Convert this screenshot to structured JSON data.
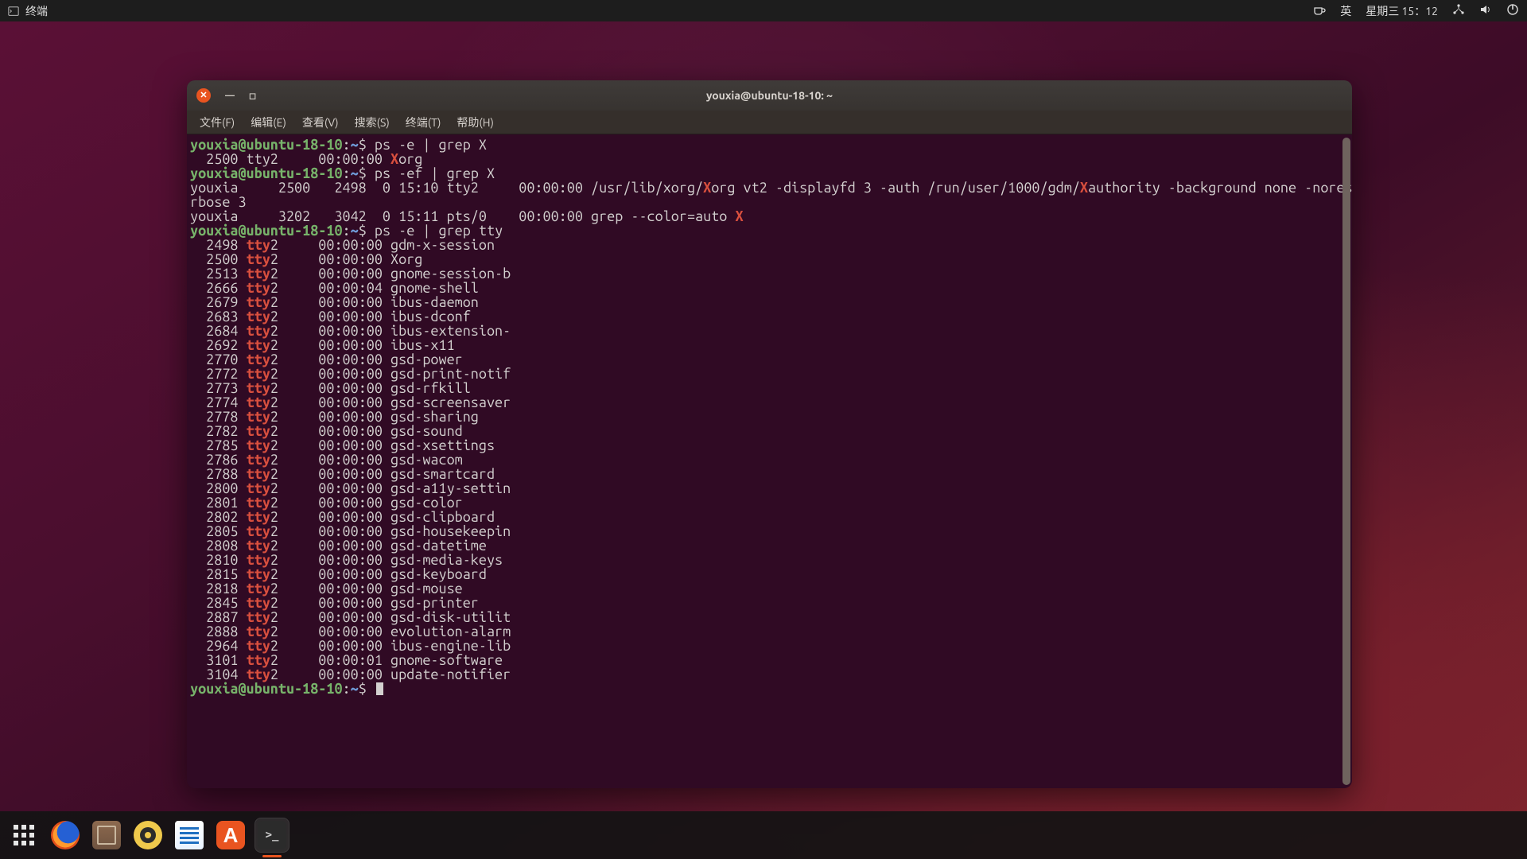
{
  "top_panel": {
    "app_label": "终端",
    "ime": "英",
    "clock": "星期三 15：12"
  },
  "window": {
    "title": "youxia@ubuntu-18-10: ~",
    "menu": [
      "文件(F)",
      "编辑(E)",
      "查看(V)",
      "搜索(S)",
      "终端(T)",
      "帮助(H)"
    ]
  },
  "terminal": {
    "prompt_user_host": "youxia@ubuntu-18-10",
    "prompt_path": "~",
    "prompt_symbol": "$",
    "commands": {
      "c1": "ps -e | grep X",
      "c2": "ps -ef | grep X",
      "c3": "ps -e | grep tty"
    },
    "line_grepX": {
      "pid": "  2500",
      "tty": "tty2",
      "time": "00:00:00",
      "pre": "",
      "hl": "X",
      "post": "org"
    },
    "ef_lines": [
      {
        "pre": "youxia     2500   2498  0 15:10 tty2     00:00:00 /usr/lib/xorg/",
        "hl1": "X",
        "mid": "org vt2 -displayfd 3 -auth /run/user/1000/gdm/",
        "hl2": "X",
        "post": "authority -background none -noreset -keeptty -ve"
      },
      {
        "pre": "rbose 3"
      },
      {
        "pre": "youxia     3202   3042  0 15:11 pts/0    00:00:00 grep --color=auto ",
        "hl1": "X"
      }
    ],
    "tty_rows": [
      {
        "pid": "  2498",
        "tty": "tty",
        "n": "2",
        "time": "00:00:00",
        "cmd": "gdm-x-session"
      },
      {
        "pid": "  2500",
        "tty": "tty",
        "n": "2",
        "time": "00:00:00",
        "cmd": "Xorg"
      },
      {
        "pid": "  2513",
        "tty": "tty",
        "n": "2",
        "time": "00:00:00",
        "cmd": "gnome-session-b"
      },
      {
        "pid": "  2666",
        "tty": "tty",
        "n": "2",
        "time": "00:00:04",
        "cmd": "gnome-shell"
      },
      {
        "pid": "  2679",
        "tty": "tty",
        "n": "2",
        "time": "00:00:00",
        "cmd": "ibus-daemon"
      },
      {
        "pid": "  2683",
        "tty": "tty",
        "n": "2",
        "time": "00:00:00",
        "cmd": "ibus-dconf"
      },
      {
        "pid": "  2684",
        "tty": "tty",
        "n": "2",
        "time": "00:00:00",
        "cmd": "ibus-extension-"
      },
      {
        "pid": "  2692",
        "tty": "tty",
        "n": "2",
        "time": "00:00:00",
        "cmd": "ibus-x11"
      },
      {
        "pid": "  2770",
        "tty": "tty",
        "n": "2",
        "time": "00:00:00",
        "cmd": "gsd-power"
      },
      {
        "pid": "  2772",
        "tty": "tty",
        "n": "2",
        "time": "00:00:00",
        "cmd": "gsd-print-notif"
      },
      {
        "pid": "  2773",
        "tty": "tty",
        "n": "2",
        "time": "00:00:00",
        "cmd": "gsd-rfkill"
      },
      {
        "pid": "  2774",
        "tty": "tty",
        "n": "2",
        "time": "00:00:00",
        "cmd": "gsd-screensaver"
      },
      {
        "pid": "  2778",
        "tty": "tty",
        "n": "2",
        "time": "00:00:00",
        "cmd": "gsd-sharing"
      },
      {
        "pid": "  2782",
        "tty": "tty",
        "n": "2",
        "time": "00:00:00",
        "cmd": "gsd-sound"
      },
      {
        "pid": "  2785",
        "tty": "tty",
        "n": "2",
        "time": "00:00:00",
        "cmd": "gsd-xsettings"
      },
      {
        "pid": "  2786",
        "tty": "tty",
        "n": "2",
        "time": "00:00:00",
        "cmd": "gsd-wacom"
      },
      {
        "pid": "  2788",
        "tty": "tty",
        "n": "2",
        "time": "00:00:00",
        "cmd": "gsd-smartcard"
      },
      {
        "pid": "  2800",
        "tty": "tty",
        "n": "2",
        "time": "00:00:00",
        "cmd": "gsd-a11y-settin"
      },
      {
        "pid": "  2801",
        "tty": "tty",
        "n": "2",
        "time": "00:00:00",
        "cmd": "gsd-color"
      },
      {
        "pid": "  2802",
        "tty": "tty",
        "n": "2",
        "time": "00:00:00",
        "cmd": "gsd-clipboard"
      },
      {
        "pid": "  2805",
        "tty": "tty",
        "n": "2",
        "time": "00:00:00",
        "cmd": "gsd-housekeepin"
      },
      {
        "pid": "  2808",
        "tty": "tty",
        "n": "2",
        "time": "00:00:00",
        "cmd": "gsd-datetime"
      },
      {
        "pid": "  2810",
        "tty": "tty",
        "n": "2",
        "time": "00:00:00",
        "cmd": "gsd-media-keys"
      },
      {
        "pid": "  2815",
        "tty": "tty",
        "n": "2",
        "time": "00:00:00",
        "cmd": "gsd-keyboard"
      },
      {
        "pid": "  2818",
        "tty": "tty",
        "n": "2",
        "time": "00:00:00",
        "cmd": "gsd-mouse"
      },
      {
        "pid": "  2845",
        "tty": "tty",
        "n": "2",
        "time": "00:00:00",
        "cmd": "gsd-printer"
      },
      {
        "pid": "  2887",
        "tty": "tty",
        "n": "2",
        "time": "00:00:00",
        "cmd": "gsd-disk-utilit"
      },
      {
        "pid": "  2888",
        "tty": "tty",
        "n": "2",
        "time": "00:00:00",
        "cmd": "evolution-alarm"
      },
      {
        "pid": "  2964",
        "tty": "tty",
        "n": "2",
        "time": "00:00:00",
        "cmd": "ibus-engine-lib"
      },
      {
        "pid": "  3101",
        "tty": "tty",
        "n": "2",
        "time": "00:00:01",
        "cmd": "gnome-software"
      },
      {
        "pid": "  3104",
        "tty": "tty",
        "n": "2",
        "time": "00:00:00",
        "cmd": "update-notifier"
      }
    ]
  },
  "dock": {
    "items": [
      {
        "name": "show-applications"
      },
      {
        "name": "firefox"
      },
      {
        "name": "files"
      },
      {
        "name": "rhythmbox"
      },
      {
        "name": "libreoffice-writer"
      },
      {
        "name": "ubuntu-software"
      },
      {
        "name": "terminal",
        "running": true,
        "active": true
      }
    ]
  }
}
